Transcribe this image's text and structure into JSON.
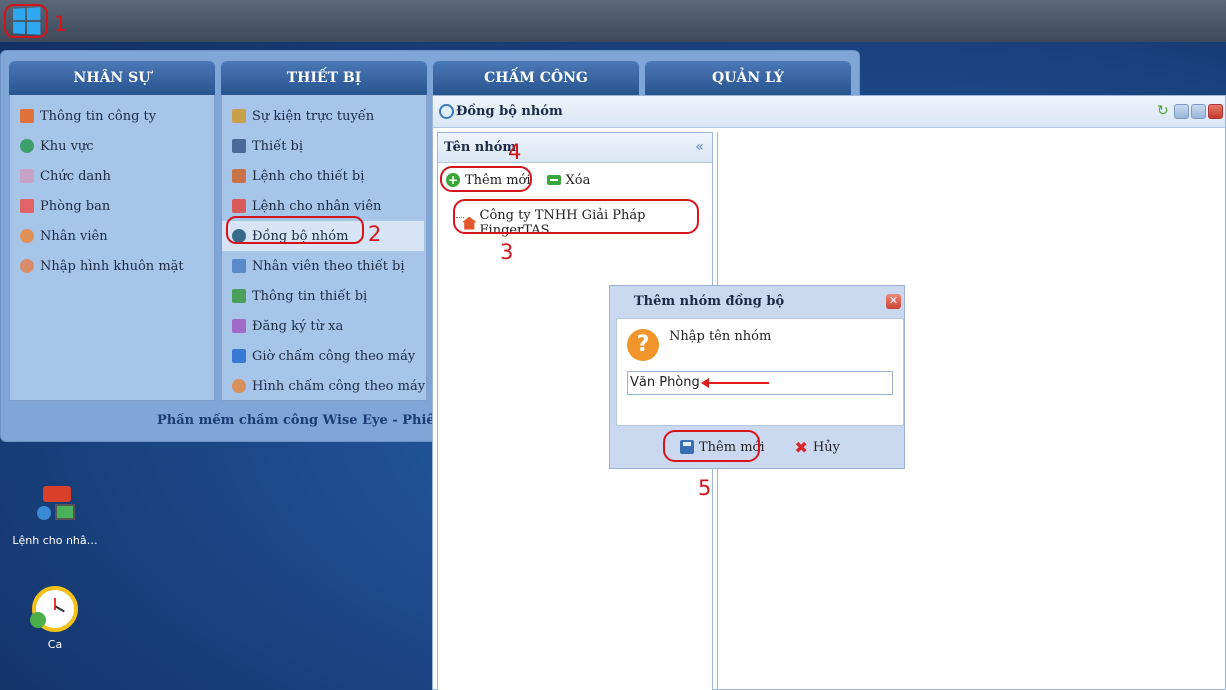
{
  "menu": {
    "columns": [
      {
        "header": "NHÂN SỰ",
        "items": [
          "Thông tin công ty",
          "Khu vực",
          "Chức danh",
          "Phòng ban",
          "Nhân viên",
          "Nhập hình khuôn mặt"
        ]
      },
      {
        "header": "THIẾT BỊ",
        "items": [
          "Sự kiện trực tuyến",
          "Thiết bị",
          "Lệnh cho thiết bị",
          "Lệnh cho nhân viên",
          "Đồng bộ nhóm",
          "Nhân viên theo thiết bị",
          "Thông tin thiết bị",
          "Đăng ký từ xa",
          "Giờ chấm công theo máy",
          "Hình chấm công theo máy"
        ]
      },
      {
        "header": "CHẤM CÔNG",
        "items": []
      },
      {
        "header": "QUẢN LÝ",
        "items": []
      }
    ],
    "footer": "Phần mềm chấm công Wise Eye - Phiên bản: I"
  },
  "window": {
    "title": "Đồng bộ nhóm",
    "panel_header": "Tên nhóm",
    "toolbar": {
      "add_label": "Thêm mới",
      "delete_label": "Xóa"
    },
    "tree_root": "Công ty TNHH Giải Pháp FingerTAS"
  },
  "dialog": {
    "title": "Thêm nhóm đồng bộ",
    "message": "Nhập tên nhóm",
    "input_value": "Văn Phòng",
    "save_label": "Thêm mới",
    "cancel_label": "Hủy"
  },
  "annotations": {
    "n1": "1",
    "n2": "2",
    "n3": "3",
    "n4": "4",
    "n5": "5"
  },
  "desktop": {
    "icon1_label": "Lệnh cho nhâ…",
    "icon2_label": "Ca"
  },
  "colors": {
    "annotation": "#d6141c",
    "header": "#27548f",
    "menu_bg": "#a7c4e9"
  }
}
